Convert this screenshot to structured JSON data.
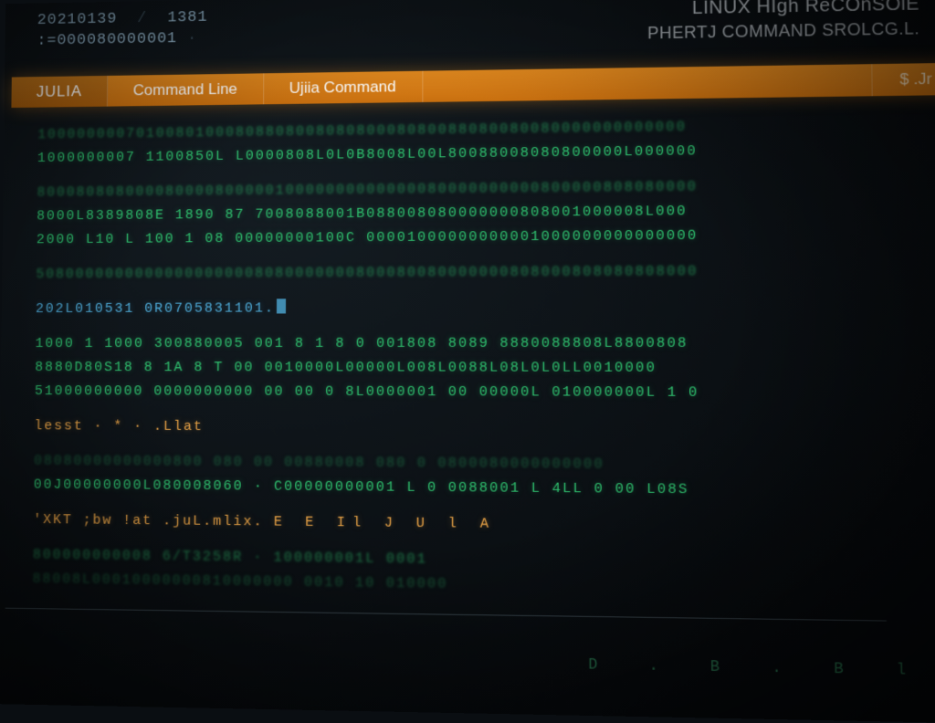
{
  "header": {
    "line1_left": "20210139",
    "line1_right": "1381",
    "line2_prefix": ":=",
    "line2_value": "000080000001",
    "line2_trail": "·",
    "title": "LINUX HIgh ReCOnSOlE",
    "subtitle": "PHERTJ COMMAND SROLCG.L."
  },
  "tabs": {
    "julia": "JULIA",
    "command_line": "Command Line",
    "ujiia": "Ujiia Command",
    "right": "$ .Jr"
  },
  "terminal": {
    "lines": [
      {
        "cls": "row dim",
        "text": "1000000007010080100080880800808080008080088080080080000000000000"
      },
      {
        "cls": "row",
        "text": "1000000007 1100850L L0000808L0L0B8008L00L80088008080800000L000000"
      },
      {
        "cls": "row gap",
        "text": ""
      },
      {
        "cls": "row dim",
        "text": "80008080800008000080000010000000000000080000000000800000808080000"
      },
      {
        "cls": "row",
        "text": "8000L8389808E 1890  87 7008088001B088008080000000808001000008L000"
      },
      {
        "cls": "row",
        "text": "2000 L10 L 100 1 08 00000000100C 00001000000000001000000000000000"
      },
      {
        "cls": "row gap",
        "text": ""
      },
      {
        "cls": "row dim",
        "text": "50800000000000000000008080000000800080080000000808000808080808000"
      },
      {
        "cls": "row gap",
        "text": ""
      },
      {
        "cls": "row blue",
        "html": "<span class=\"blue\">202L010531  0R0705831101.</span><span class=\"cursor\"></span>"
      },
      {
        "cls": "row gap",
        "text": ""
      },
      {
        "cls": "row",
        "text": "1000  1 1000 300880005 001  8 1 8 0 001808 8089 8880088808L8800808"
      },
      {
        "cls": "row",
        "text": "8880D80S18 8 1A 8 T    00 0010000L00000L008L0088L08L0L0LL0010000"
      },
      {
        "cls": "row",
        "text": "51000000000 0000000000 00 00 0 8L0000001 00 00000L 010000000L 1 0"
      },
      {
        "cls": "row gap",
        "text": ""
      },
      {
        "cls": "row amber",
        "text": "lesst · * · .Llat"
      },
      {
        "cls": "row gap",
        "text": ""
      },
      {
        "cls": "row faint",
        "text": "08080000000000800 080   00       00880008   080 0 0800080000000000"
      },
      {
        "cls": "row",
        "text": "00J00000000L080008060 · C00000000001 L 0 0088001 L  4LL 0 00 L08S"
      },
      {
        "cls": "row gap",
        "text": ""
      },
      {
        "cls": "row amber",
        "html": "<span class=\"amber\">'XKT   ;bw !at  .juL.mlix.</span>   <span style=\"letter-spacing:8px\">E  E  Il   J U l  A</span>"
      },
      {
        "cls": "row gap",
        "text": ""
      },
      {
        "cls": "row dim",
        "text": "800000000008  6/T3258R · 100000001L  0001"
      },
      {
        "cls": "row faint",
        "text": "88008L00010000000810000000 0010 10 010000"
      }
    ]
  },
  "footer": {
    "glyphs": "D . B . B   l"
  }
}
